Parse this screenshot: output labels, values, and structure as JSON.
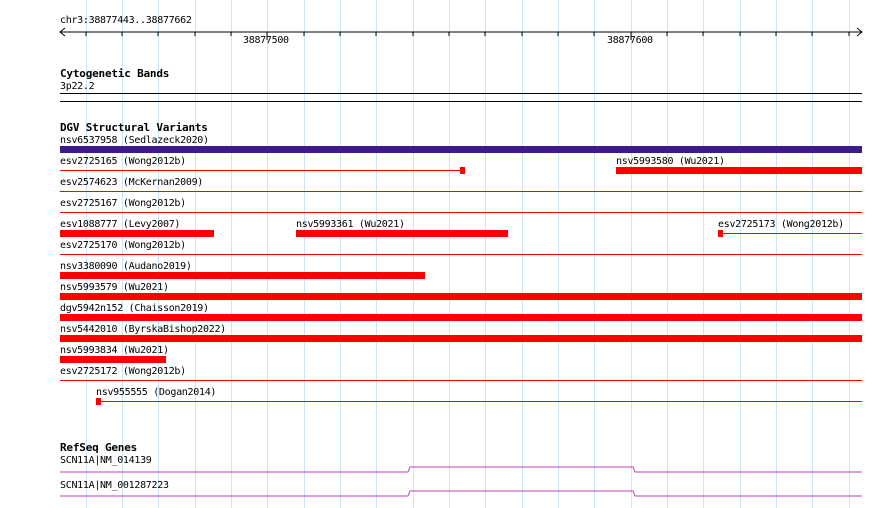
{
  "ruler": {
    "range_label": "chr3:38877443..38877662",
    "tick_labels": [
      "38877500",
      "38877600"
    ]
  },
  "cytoband": {
    "title": "Cytogenetic Bands",
    "band_label": "3p22.2"
  },
  "dgv": {
    "title": "DGV Structural Variants",
    "variants": [
      {
        "label": "nsv6537958 (Sedlazeck2020)",
        "color": "#3c1a8c"
      },
      {
        "label": "esv2725165 (Wong2012b)",
        "color": "#ff0000"
      },
      {
        "label": "nsv5993580 (Wu2021)",
        "color": "#ff0000"
      },
      {
        "label": "esv2574623 (McKernan2009)",
        "color": "#ff0000"
      },
      {
        "label": "esv2725167 (Wong2012b)",
        "color": "#ff0000"
      },
      {
        "label": "esv1088777 (Levy2007)",
        "color": "#ff0000"
      },
      {
        "label": "nsv5993361 (Wu2021)",
        "color": "#ff0000"
      },
      {
        "label": "esv2725173 (Wong2012b)",
        "color": "#ff0000"
      },
      {
        "label": "esv2725170 (Wong2012b)",
        "color": "#ff0000"
      },
      {
        "label": "nsv3380090 (Audano2019)",
        "color": "#ff0000"
      },
      {
        "label": "nsv5993579 (Wu2021)",
        "color": "#ff0000"
      },
      {
        "label": "dgv5942n152 (Chaisson2019)",
        "color": "#ff0000"
      },
      {
        "label": "nsv5442010 (ByrskaBishop2022)",
        "color": "#ff0000"
      },
      {
        "label": "nsv5993834 (Wu2021)",
        "color": "#ff0000"
      },
      {
        "label": "esv2725172 (Wong2012b)",
        "color": "#ff0000"
      },
      {
        "label": "nsv955555 (Dogan2014)",
        "color": "#ff0000"
      }
    ]
  },
  "refseq": {
    "title": "RefSeq Genes",
    "genes": [
      {
        "label": "SCN11A|NM_014139",
        "color": "#c040c0"
      },
      {
        "label": "SCN11A|NM_001287223",
        "color": "#c040c0"
      }
    ]
  }
}
